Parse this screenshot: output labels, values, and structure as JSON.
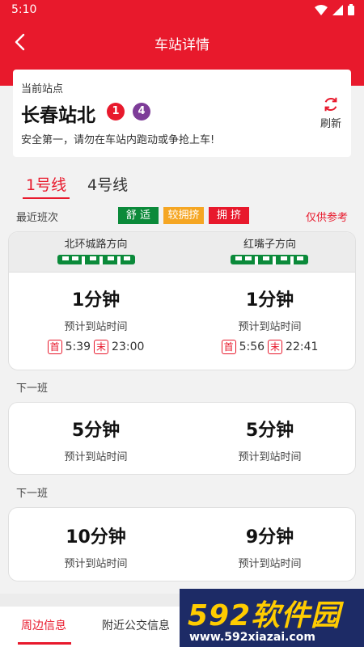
{
  "status_bar": {
    "time": "5:10"
  },
  "header": {
    "title": "车站详情"
  },
  "station": {
    "current_label": "当前站点",
    "name": "长春站北",
    "lines": [
      {
        "label": "1",
        "color": "#e8192c"
      },
      {
        "label": "4",
        "color": "#7d3c98"
      }
    ],
    "notice": "安全第一，请勿在车站内跑动或争抢上车!",
    "refresh_label": "刷新"
  },
  "line_tabs": [
    {
      "label": "1号线",
      "active": true
    },
    {
      "label": "4号线",
      "active": false
    }
  ],
  "recent": {
    "label": "最近班次",
    "legend": [
      {
        "label": "舒 适",
        "color": "#0b8a3a"
      },
      {
        "label": "较拥挤",
        "color": "#f5a623"
      },
      {
        "label": "拥 挤",
        "color": "#e8192c"
      }
    ],
    "reference": "仅供参考"
  },
  "directions": [
    {
      "name": "北环城路方向",
      "first_mark": "首",
      "first_time": "5:39",
      "last_mark": "末",
      "last_time": "23:00"
    },
    {
      "name": "红嘴子方向",
      "first_mark": "首",
      "first_time": "5:56",
      "last_mark": "末",
      "last_time": "22:41"
    }
  ],
  "arrivals": [
    {
      "label": "",
      "times": [
        "1分钟",
        "1分钟"
      ]
    },
    {
      "label": "下一班",
      "times": [
        "5分钟",
        "5分钟"
      ]
    },
    {
      "label": "下一班",
      "times": [
        "10分钟",
        "9分钟"
      ]
    }
  ],
  "eta_label": "预计到站时间",
  "bottom_tabs": [
    {
      "label": "周边信息",
      "active": true
    },
    {
      "label": "附近公交信息",
      "active": false
    }
  ],
  "watermark": {
    "brand": "592软件园",
    "url": "www.592xiazai.com"
  },
  "colors": {
    "primary": "#e8192c",
    "train": "#0b8a3a"
  }
}
